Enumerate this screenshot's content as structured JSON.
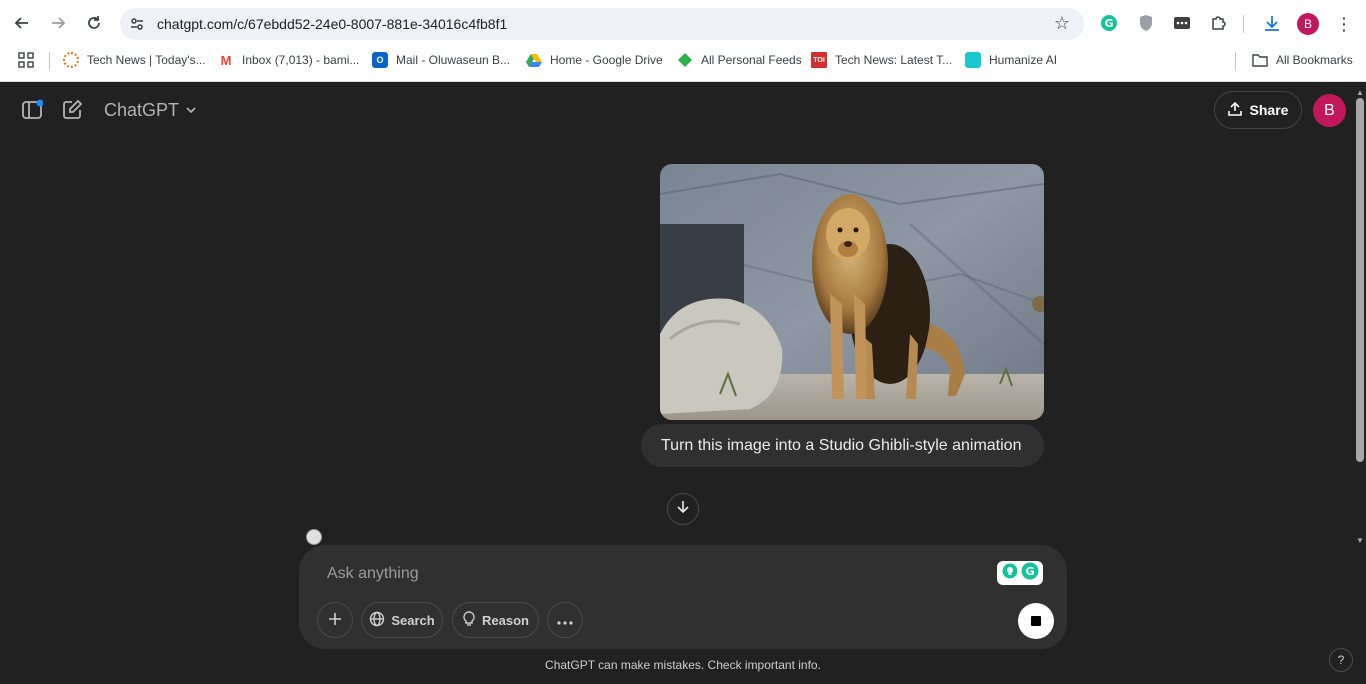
{
  "browser": {
    "url": "chatgpt.com/c/67ebdd52-24e0-8007-881e-34016c4fb8f1",
    "profile_initial": "B",
    "nav_icons": [
      "back-icon",
      "forward-icon",
      "reload-icon"
    ],
    "bookmarks": [
      {
        "label": "Tech News | Today's...",
        "icon": "tech-news-favicon",
        "color": "#e8711a"
      },
      {
        "label": "Inbox (7,013) - bami...",
        "icon": "gmail-favicon",
        "color": "#ea4335"
      },
      {
        "label": "Mail - Oluwaseun B...",
        "icon": "outlook-favicon",
        "color": "#0a64c8"
      },
      {
        "label": "Home - Google Drive",
        "icon": "google-drive-favicon",
        "color": "#fbbc04"
      },
      {
        "label": "All Personal Feeds",
        "icon": "feedly-favicon",
        "color": "#2bb24c"
      },
      {
        "label": "Tech News: Latest T...",
        "icon": "toi-favicon",
        "color": "#d32f2f"
      },
      {
        "label": "Humanize AI",
        "icon": "humanize-ai-favicon",
        "color": "#1cc7d0"
      }
    ],
    "all_bookmarks_label": "All Bookmarks"
  },
  "header": {
    "model_title": "ChatGPT",
    "share_label": "Share",
    "avatar_initial": "B"
  },
  "conversation": {
    "user_image": "lion-photo",
    "user_message": "Turn this image into a Studio Ghibli-style animation"
  },
  "composer": {
    "placeholder": "Ask anything",
    "search_label": "Search",
    "reason_label": "Reason"
  },
  "footer": {
    "disclaimer": "ChatGPT can make mistakes. Check important info.",
    "help_label": "?"
  },
  "colors": {
    "app_bg": "#212121",
    "bubble_bg": "#303030",
    "avatar_bg": "#c2185b",
    "grammarly": "#15c39a"
  }
}
